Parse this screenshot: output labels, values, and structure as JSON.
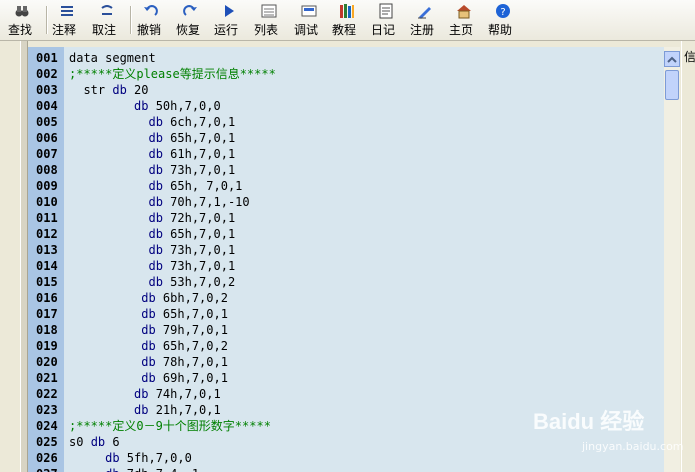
{
  "toolbar": [
    {
      "id": "find",
      "label": "查找",
      "icon": "binoculars-icon"
    },
    {
      "id": "comment",
      "label": "注释",
      "icon": "comment-lines-icon"
    },
    {
      "id": "uncomment",
      "label": "取注",
      "icon": "uncomment-icon"
    },
    {
      "id": "undo",
      "label": "撤销",
      "icon": "undo-icon"
    },
    {
      "id": "redo",
      "label": "恢复",
      "icon": "redo-icon"
    },
    {
      "id": "run",
      "label": "运行",
      "icon": "run-icon"
    },
    {
      "id": "list",
      "label": "列表",
      "icon": "list-icon"
    },
    {
      "id": "debug",
      "label": "调试",
      "icon": "debug-icon"
    },
    {
      "id": "tutorial",
      "label": "教程",
      "icon": "books-icon"
    },
    {
      "id": "diary",
      "label": "日记",
      "icon": "diary-icon"
    },
    {
      "id": "register",
      "label": "注册",
      "icon": "pen-icon"
    },
    {
      "id": "home",
      "label": "主页",
      "icon": "house-icon"
    },
    {
      "id": "help",
      "label": "帮助",
      "icon": "help-icon"
    }
  ],
  "right_panel": {
    "label": "信"
  },
  "colors": {
    "keyword": "#00007f",
    "comment": "#008000",
    "gutter": "#a9c5e4",
    "editor_bg": "#d8e6ee"
  },
  "lines": [
    {
      "n": "001",
      "indent": "",
      "kw": "",
      "text": "data segment",
      "cls": "plain"
    },
    {
      "n": "002",
      "indent": "",
      "kw": "",
      "text": ";*****定义please等提示信息*****",
      "cls": "cm"
    },
    {
      "n": "003",
      "indent": "  str ",
      "kw": "db",
      "text": " 20",
      "cls": "plain"
    },
    {
      "n": "004",
      "indent": "         ",
      "kw": "db",
      "text": " 50h,7,0,0",
      "cls": "plain"
    },
    {
      "n": "005",
      "indent": "           ",
      "kw": "db",
      "text": " 6ch,7,0,1",
      "cls": "plain"
    },
    {
      "n": "006",
      "indent": "           ",
      "kw": "db",
      "text": " 65h,7,0,1",
      "cls": "plain"
    },
    {
      "n": "007",
      "indent": "           ",
      "kw": "db",
      "text": " 61h,7,0,1",
      "cls": "plain"
    },
    {
      "n": "008",
      "indent": "           ",
      "kw": "db",
      "text": " 73h,7,0,1",
      "cls": "plain"
    },
    {
      "n": "009",
      "indent": "           ",
      "kw": "db",
      "text": " 65h, 7,0,1",
      "cls": "plain"
    },
    {
      "n": "010",
      "indent": "           ",
      "kw": "db",
      "text": " 70h,7,1,-10",
      "cls": "plain"
    },
    {
      "n": "011",
      "indent": "           ",
      "kw": "db",
      "text": " 72h,7,0,1",
      "cls": "plain"
    },
    {
      "n": "012",
      "indent": "           ",
      "kw": "db",
      "text": " 65h,7,0,1",
      "cls": "plain"
    },
    {
      "n": "013",
      "indent": "           ",
      "kw": "db",
      "text": " 73h,7,0,1",
      "cls": "plain"
    },
    {
      "n": "014",
      "indent": "           ",
      "kw": "db",
      "text": " 73h,7,0,1",
      "cls": "plain"
    },
    {
      "n": "015",
      "indent": "           ",
      "kw": "db",
      "text": " 53h,7,0,2",
      "cls": "plain"
    },
    {
      "n": "016",
      "indent": "          ",
      "kw": "db",
      "text": " 6bh,7,0,2",
      "cls": "plain"
    },
    {
      "n": "017",
      "indent": "          ",
      "kw": "db",
      "text": " 65h,7,0,1",
      "cls": "plain"
    },
    {
      "n": "018",
      "indent": "          ",
      "kw": "db",
      "text": " 79h,7,0,1",
      "cls": "plain"
    },
    {
      "n": "019",
      "indent": "          ",
      "kw": "db",
      "text": " 65h,7,0,2",
      "cls": "plain"
    },
    {
      "n": "020",
      "indent": "          ",
      "kw": "db",
      "text": " 78h,7,0,1",
      "cls": "plain"
    },
    {
      "n": "021",
      "indent": "          ",
      "kw": "db",
      "text": " 69h,7,0,1",
      "cls": "plain"
    },
    {
      "n": "022",
      "indent": "         ",
      "kw": "db",
      "text": " 74h,7,0,1",
      "cls": "plain"
    },
    {
      "n": "023",
      "indent": "         ",
      "kw": "db",
      "text": " 21h,7,0,1",
      "cls": "plain"
    },
    {
      "n": "024",
      "indent": "",
      "kw": "",
      "text": ";*****定义0－9十个图形数字*****",
      "cls": "cm"
    },
    {
      "n": "025",
      "indent": "s0 ",
      "kw": "db",
      "text": " 6",
      "cls": "plain"
    },
    {
      "n": "026",
      "indent": "     ",
      "kw": "db",
      "text": " 5fh,7,0,0",
      "cls": "plain"
    },
    {
      "n": "027",
      "indent": "     ",
      "kw": "db",
      "text": " 7dh,7,4,-1",
      "cls": "plain"
    }
  ],
  "watermark": {
    "brand": "Baidu 经验",
    "url": "jingyan.baidu.com"
  }
}
